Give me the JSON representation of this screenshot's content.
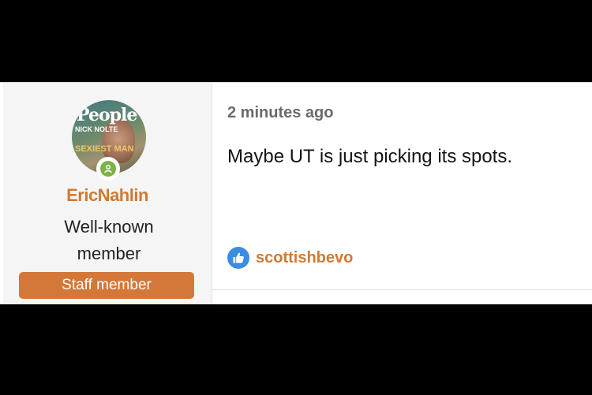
{
  "post": {
    "user": {
      "avatar_cover_title": "People",
      "avatar_cover_line1": "NICK NOLTE",
      "avatar_cover_line2": "SEXIEST MAN",
      "username": "EricNahlin",
      "title": "Well-known member",
      "badge": "Staff member",
      "online": true,
      "colors": {
        "username": "#d07a34",
        "badge": "#d4783a",
        "online": "#7cb342"
      }
    },
    "timestamp": "2 minutes ago",
    "message": "Maybe UT is just picking its spots.",
    "reactions": {
      "icon": "thumbs-up-icon",
      "users": "scottishbevo",
      "colors": {
        "icon": "#3b8ce3"
      }
    }
  }
}
